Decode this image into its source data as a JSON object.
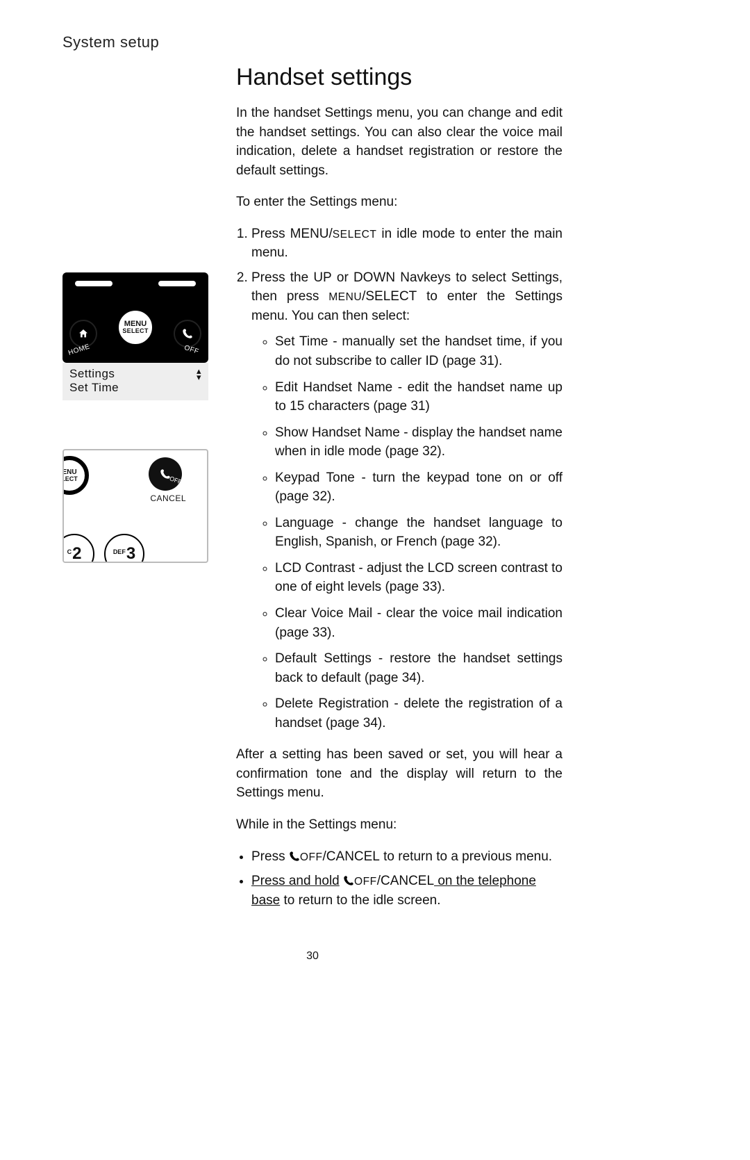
{
  "section_label": "System setup",
  "page_title": "Handset settings",
  "intro_a": "In the handset ",
  "intro_settings": "Settings",
  "intro_b": " menu, you can change and edit the handset settings. You can also clear the voice mail indication, delete a handset registration or restore the default settings.",
  "enter_a": "To enter the ",
  "enter_b": " menu:",
  "step1_a": "Press ",
  "step1_menu": "MENU",
  "step1_slash": "/",
  "step1_select": "SELECT",
  "step1_b": " in idle mode to enter the main menu.",
  "step2_a": "Press the ",
  "step2_up": "UP",
  "step2_or": " or ",
  "step2_down": "DOWN",
  "step2_b": " Navkeys to select ",
  "step2_settings": "Settings",
  "step2_c": ", then press ",
  "step2_menu": "MENU",
  "step2_select": "SELECT",
  "step2_d": " to enter the Settings menu. You can then select:",
  "options": [
    {
      "name": "Set Time",
      "desc": " - manually set the handset time, if you do not subscribe to caller ID (page 31)."
    },
    {
      "name": "Edit Handset Name",
      "desc": " - edit the handset name up to 15 characters (page 31)"
    },
    {
      "name": "Show Handset Name",
      "desc": " - display the handset name when in idle mode (page 32)."
    },
    {
      "name": "Keypad Tone",
      "desc": " - turn the keypad tone on or off (page 32)."
    },
    {
      "name": "Language",
      "desc": " - change the handset language to English, Spanish, or French (page 32)."
    },
    {
      "name": "LCD Contrast",
      "desc": " - adjust the LCD screen contrast to one of eight levels (page 33)."
    },
    {
      "name": "Clear Voice Mail",
      "desc": " - clear the voice mail indication (page 33)."
    },
    {
      "name": "Default Settings",
      "desc": " - restore the handset settings back to default (page 34)."
    },
    {
      "name": "Delete Registration",
      "desc": " - delete the registration of a handset (page 34)."
    }
  ],
  "after_a": "After a setting has been saved or set, you will hear a confirmation tone and the display will return to the ",
  "after_b": " menu.",
  "while_a": "While in the ",
  "while_b": " menu:",
  "close1_a": "Press ",
  "off": "OFF",
  "cancel": "CANCEL",
  "close1_b": " to return to a previous menu.",
  "close2_a": "Press and hold",
  "close2_b": " on the telephone base",
  "close2_c": " to return to the idle screen.",
  "page_number": "30",
  "fig1": {
    "menu_top": "MENU",
    "menu_bottom": "SELECT",
    "home_label": "HOME",
    "off_label": "OFF",
    "screen_line1": "Settings",
    "screen_line2": "Set Time"
  },
  "fig2": {
    "menu_top": "ENU",
    "menu_bottom": "LECT",
    "off_label": "OFF",
    "cancel_label": "CANCEL",
    "key2_letters": "C",
    "key2_num": "2",
    "key3_letters": "DEF",
    "key3_num": "3"
  }
}
